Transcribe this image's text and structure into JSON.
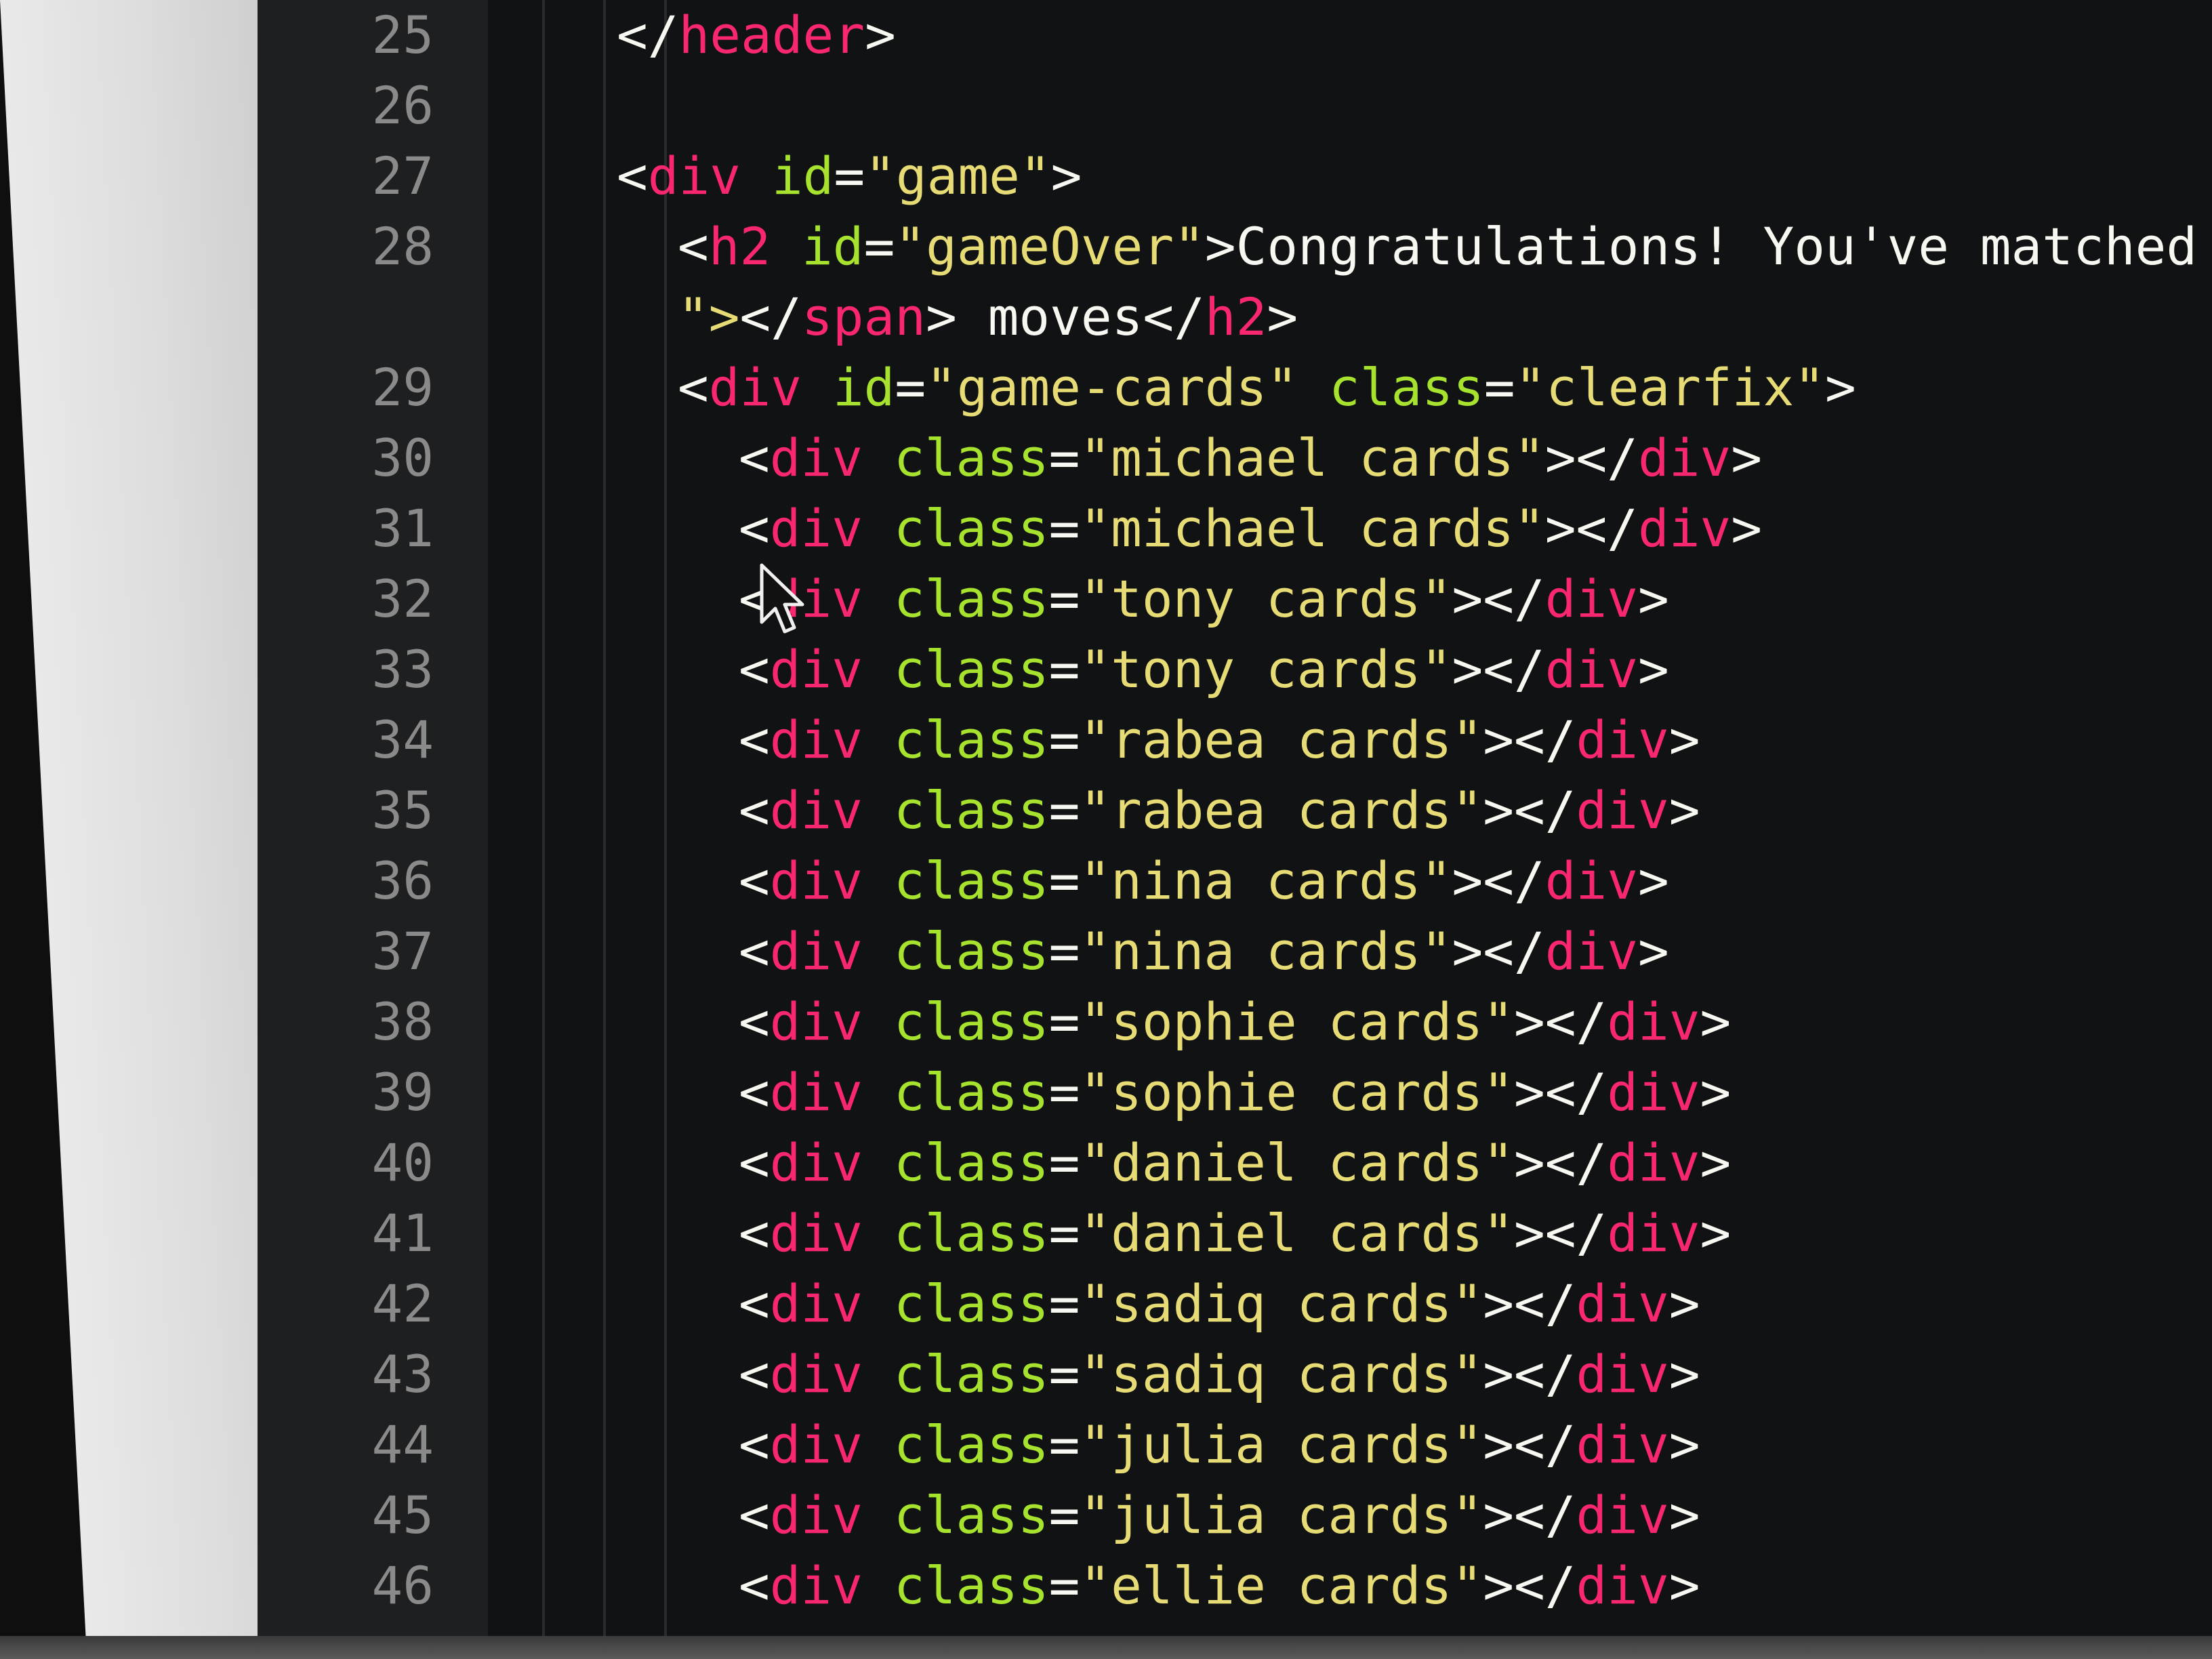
{
  "colors": {
    "tag": "#f92672",
    "attr": "#a6e22e",
    "string": "#e6db74",
    "punct": "#f8f8f2",
    "text": "#f8f8f2",
    "line_number": "#8a8a8a"
  },
  "editor": {
    "lines": [
      {
        "number": "25",
        "indent": 0,
        "tokens": [
          {
            "t": "</",
            "c": "punct"
          },
          {
            "t": "header",
            "c": "tag"
          },
          {
            "t": ">",
            "c": "punct"
          }
        ]
      },
      {
        "number": "26",
        "indent": 0,
        "tokens": []
      },
      {
        "number": "27",
        "indent": 0,
        "tokens": [
          {
            "t": "<",
            "c": "punct"
          },
          {
            "t": "div",
            "c": "tag"
          },
          {
            "t": " ",
            "c": "punct"
          },
          {
            "t": "id",
            "c": "attr"
          },
          {
            "t": "=",
            "c": "punct"
          },
          {
            "t": "\"game\"",
            "c": "string"
          },
          {
            "t": ">",
            "c": "punct"
          }
        ]
      },
      {
        "number": "28",
        "indent": 1,
        "tokens": [
          {
            "t": "<",
            "c": "punct"
          },
          {
            "t": "h2",
            "c": "tag"
          },
          {
            "t": " ",
            "c": "punct"
          },
          {
            "t": "id",
            "c": "attr"
          },
          {
            "t": "=",
            "c": "punct"
          },
          {
            "t": "\"gameOver\"",
            "c": "string"
          },
          {
            "t": ">",
            "c": "punct"
          },
          {
            "t": "Congratulations! You've matched al",
            "c": "text"
          }
        ]
      },
      {
        "number": "",
        "indent": 1,
        "tokens": [
          {
            "t": "\">",
            "c": "string"
          },
          {
            "t": "</",
            "c": "punct"
          },
          {
            "t": "span",
            "c": "tag"
          },
          {
            "t": ">",
            "c": "punct"
          },
          {
            "t": " moves",
            "c": "text"
          },
          {
            "t": "</",
            "c": "punct"
          },
          {
            "t": "h2",
            "c": "tag"
          },
          {
            "t": ">",
            "c": "punct"
          }
        ]
      },
      {
        "number": "29",
        "indent": 1,
        "tokens": [
          {
            "t": "<",
            "c": "punct"
          },
          {
            "t": "div",
            "c": "tag"
          },
          {
            "t": " ",
            "c": "punct"
          },
          {
            "t": "id",
            "c": "attr"
          },
          {
            "t": "=",
            "c": "punct"
          },
          {
            "t": "\"game-cards\"",
            "c": "string"
          },
          {
            "t": " ",
            "c": "punct"
          },
          {
            "t": "class",
            "c": "attr"
          },
          {
            "t": "=",
            "c": "punct"
          },
          {
            "t": "\"clearfix\"",
            "c": "string"
          },
          {
            "t": ">",
            "c": "punct"
          }
        ]
      },
      {
        "number": "30",
        "indent": 2,
        "tokens": [
          {
            "t": "<",
            "c": "punct"
          },
          {
            "t": "div",
            "c": "tag"
          },
          {
            "t": " ",
            "c": "punct"
          },
          {
            "t": "class",
            "c": "attr"
          },
          {
            "t": "=",
            "c": "punct"
          },
          {
            "t": "\"michael cards\"",
            "c": "string"
          },
          {
            "t": "></",
            "c": "punct"
          },
          {
            "t": "div",
            "c": "tag"
          },
          {
            "t": ">",
            "c": "punct"
          }
        ]
      },
      {
        "number": "31",
        "indent": 2,
        "tokens": [
          {
            "t": "<",
            "c": "punct"
          },
          {
            "t": "div",
            "c": "tag"
          },
          {
            "t": " ",
            "c": "punct"
          },
          {
            "t": "class",
            "c": "attr"
          },
          {
            "t": "=",
            "c": "punct"
          },
          {
            "t": "\"michael cards\"",
            "c": "string"
          },
          {
            "t": "></",
            "c": "punct"
          },
          {
            "t": "div",
            "c": "tag"
          },
          {
            "t": ">",
            "c": "punct"
          }
        ]
      },
      {
        "number": "32",
        "indent": 2,
        "tokens": [
          {
            "t": "<",
            "c": "punct"
          },
          {
            "t": "div",
            "c": "tag"
          },
          {
            "t": " ",
            "c": "punct"
          },
          {
            "t": "class",
            "c": "attr"
          },
          {
            "t": "=",
            "c": "punct"
          },
          {
            "t": "\"tony cards\"",
            "c": "string"
          },
          {
            "t": "></",
            "c": "punct"
          },
          {
            "t": "div",
            "c": "tag"
          },
          {
            "t": ">",
            "c": "punct"
          }
        ]
      },
      {
        "number": "33",
        "indent": 2,
        "tokens": [
          {
            "t": "<",
            "c": "punct"
          },
          {
            "t": "div",
            "c": "tag"
          },
          {
            "t": " ",
            "c": "punct"
          },
          {
            "t": "class",
            "c": "attr"
          },
          {
            "t": "=",
            "c": "punct"
          },
          {
            "t": "\"tony cards\"",
            "c": "string"
          },
          {
            "t": "></",
            "c": "punct"
          },
          {
            "t": "div",
            "c": "tag"
          },
          {
            "t": ">",
            "c": "punct"
          }
        ]
      },
      {
        "number": "34",
        "indent": 2,
        "tokens": [
          {
            "t": "<",
            "c": "punct"
          },
          {
            "t": "div",
            "c": "tag"
          },
          {
            "t": " ",
            "c": "punct"
          },
          {
            "t": "class",
            "c": "attr"
          },
          {
            "t": "=",
            "c": "punct"
          },
          {
            "t": "\"rabea cards\"",
            "c": "string"
          },
          {
            "t": "></",
            "c": "punct"
          },
          {
            "t": "div",
            "c": "tag"
          },
          {
            "t": ">",
            "c": "punct"
          }
        ]
      },
      {
        "number": "35",
        "indent": 2,
        "tokens": [
          {
            "t": "<",
            "c": "punct"
          },
          {
            "t": "div",
            "c": "tag"
          },
          {
            "t": " ",
            "c": "punct"
          },
          {
            "t": "class",
            "c": "attr"
          },
          {
            "t": "=",
            "c": "punct"
          },
          {
            "t": "\"rabea cards\"",
            "c": "string"
          },
          {
            "t": "></",
            "c": "punct"
          },
          {
            "t": "div",
            "c": "tag"
          },
          {
            "t": ">",
            "c": "punct"
          }
        ]
      },
      {
        "number": "36",
        "indent": 2,
        "tokens": [
          {
            "t": "<",
            "c": "punct"
          },
          {
            "t": "div",
            "c": "tag"
          },
          {
            "t": " ",
            "c": "punct"
          },
          {
            "t": "class",
            "c": "attr"
          },
          {
            "t": "=",
            "c": "punct"
          },
          {
            "t": "\"nina cards\"",
            "c": "string"
          },
          {
            "t": "></",
            "c": "punct"
          },
          {
            "t": "div",
            "c": "tag"
          },
          {
            "t": ">",
            "c": "punct"
          }
        ]
      },
      {
        "number": "37",
        "indent": 2,
        "tokens": [
          {
            "t": "<",
            "c": "punct"
          },
          {
            "t": "div",
            "c": "tag"
          },
          {
            "t": " ",
            "c": "punct"
          },
          {
            "t": "class",
            "c": "attr"
          },
          {
            "t": "=",
            "c": "punct"
          },
          {
            "t": "\"nina cards\"",
            "c": "string"
          },
          {
            "t": "></",
            "c": "punct"
          },
          {
            "t": "div",
            "c": "tag"
          },
          {
            "t": ">",
            "c": "punct"
          }
        ]
      },
      {
        "number": "38",
        "indent": 2,
        "tokens": [
          {
            "t": "<",
            "c": "punct"
          },
          {
            "t": "div",
            "c": "tag"
          },
          {
            "t": " ",
            "c": "punct"
          },
          {
            "t": "class",
            "c": "attr"
          },
          {
            "t": "=",
            "c": "punct"
          },
          {
            "t": "\"sophie cards\"",
            "c": "string"
          },
          {
            "t": "></",
            "c": "punct"
          },
          {
            "t": "div",
            "c": "tag"
          },
          {
            "t": ">",
            "c": "punct"
          }
        ]
      },
      {
        "number": "39",
        "indent": 2,
        "tokens": [
          {
            "t": "<",
            "c": "punct"
          },
          {
            "t": "div",
            "c": "tag"
          },
          {
            "t": " ",
            "c": "punct"
          },
          {
            "t": "class",
            "c": "attr"
          },
          {
            "t": "=",
            "c": "punct"
          },
          {
            "t": "\"sophie cards\"",
            "c": "string"
          },
          {
            "t": "></",
            "c": "punct"
          },
          {
            "t": "div",
            "c": "tag"
          },
          {
            "t": ">",
            "c": "punct"
          }
        ]
      },
      {
        "number": "40",
        "indent": 2,
        "tokens": [
          {
            "t": "<",
            "c": "punct"
          },
          {
            "t": "div",
            "c": "tag"
          },
          {
            "t": " ",
            "c": "punct"
          },
          {
            "t": "class",
            "c": "attr"
          },
          {
            "t": "=",
            "c": "punct"
          },
          {
            "t": "\"daniel cards\"",
            "c": "string"
          },
          {
            "t": "></",
            "c": "punct"
          },
          {
            "t": "div",
            "c": "tag"
          },
          {
            "t": ">",
            "c": "punct"
          }
        ]
      },
      {
        "number": "41",
        "indent": 2,
        "tokens": [
          {
            "t": "<",
            "c": "punct"
          },
          {
            "t": "div",
            "c": "tag"
          },
          {
            "t": " ",
            "c": "punct"
          },
          {
            "t": "class",
            "c": "attr"
          },
          {
            "t": "=",
            "c": "punct"
          },
          {
            "t": "\"daniel cards\"",
            "c": "string"
          },
          {
            "t": "></",
            "c": "punct"
          },
          {
            "t": "div",
            "c": "tag"
          },
          {
            "t": ">",
            "c": "punct"
          }
        ]
      },
      {
        "number": "42",
        "indent": 2,
        "tokens": [
          {
            "t": "<",
            "c": "punct"
          },
          {
            "t": "div",
            "c": "tag"
          },
          {
            "t": " ",
            "c": "punct"
          },
          {
            "t": "class",
            "c": "attr"
          },
          {
            "t": "=",
            "c": "punct"
          },
          {
            "t": "\"sadiq cards\"",
            "c": "string"
          },
          {
            "t": "></",
            "c": "punct"
          },
          {
            "t": "div",
            "c": "tag"
          },
          {
            "t": ">",
            "c": "punct"
          }
        ]
      },
      {
        "number": "43",
        "indent": 2,
        "tokens": [
          {
            "t": "<",
            "c": "punct"
          },
          {
            "t": "div",
            "c": "tag"
          },
          {
            "t": " ",
            "c": "punct"
          },
          {
            "t": "class",
            "c": "attr"
          },
          {
            "t": "=",
            "c": "punct"
          },
          {
            "t": "\"sadiq cards\"",
            "c": "string"
          },
          {
            "t": "></",
            "c": "punct"
          },
          {
            "t": "div",
            "c": "tag"
          },
          {
            "t": ">",
            "c": "punct"
          }
        ]
      },
      {
        "number": "44",
        "indent": 2,
        "tokens": [
          {
            "t": "<",
            "c": "punct"
          },
          {
            "t": "div",
            "c": "tag"
          },
          {
            "t": " ",
            "c": "punct"
          },
          {
            "t": "class",
            "c": "attr"
          },
          {
            "t": "=",
            "c": "punct"
          },
          {
            "t": "\"julia cards\"",
            "c": "string"
          },
          {
            "t": "></",
            "c": "punct"
          },
          {
            "t": "div",
            "c": "tag"
          },
          {
            "t": ">",
            "c": "punct"
          }
        ]
      },
      {
        "number": "45",
        "indent": 2,
        "tokens": [
          {
            "t": "<",
            "c": "punct"
          },
          {
            "t": "div",
            "c": "tag"
          },
          {
            "t": " ",
            "c": "punct"
          },
          {
            "t": "class",
            "c": "attr"
          },
          {
            "t": "=",
            "c": "punct"
          },
          {
            "t": "\"julia cards\"",
            "c": "string"
          },
          {
            "t": "></",
            "c": "punct"
          },
          {
            "t": "div",
            "c": "tag"
          },
          {
            "t": ">",
            "c": "punct"
          }
        ]
      },
      {
        "number": "46",
        "indent": 2,
        "tokens": [
          {
            "t": "<",
            "c": "punct"
          },
          {
            "t": "div",
            "c": "tag"
          },
          {
            "t": " ",
            "c": "punct"
          },
          {
            "t": "class",
            "c": "attr"
          },
          {
            "t": "=",
            "c": "punct"
          },
          {
            "t": "\"ellie cards\"",
            "c": "string"
          },
          {
            "t": "></",
            "c": "punct"
          },
          {
            "t": "div",
            "c": "tag"
          },
          {
            "t": ">",
            "c": "punct"
          }
        ]
      }
    ]
  }
}
